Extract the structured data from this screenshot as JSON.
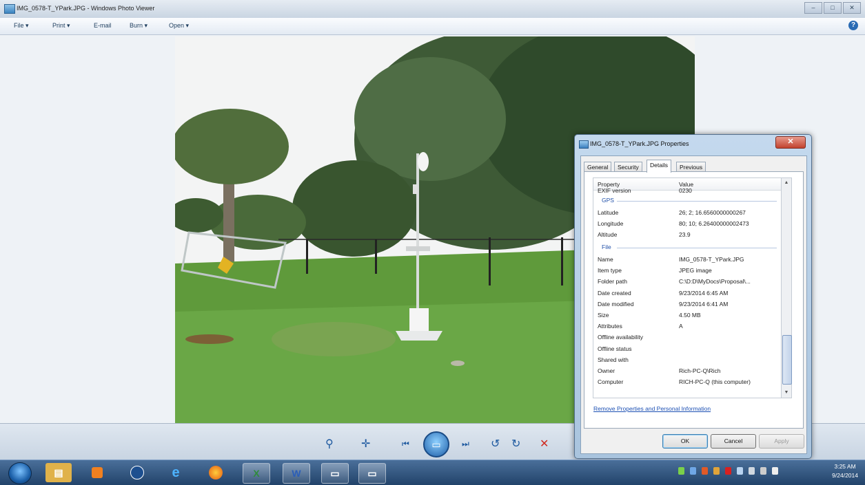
{
  "window": {
    "title": "IMG_0578-T_YPark.JPG - Windows Photo Viewer"
  },
  "menu": [
    {
      "label": "File ▾",
      "name": "menu-file"
    },
    {
      "label": "Print ▾",
      "name": "menu-print"
    },
    {
      "label": "E-mail",
      "name": "menu-email"
    },
    {
      "label": "Burn ▾",
      "name": "menu-burn"
    },
    {
      "label": "Open ▾",
      "name": "menu-open"
    }
  ],
  "dialog": {
    "title": "IMG_0578-T_YPark.JPG Properties",
    "tabs": [
      "General",
      "Security",
      "Details",
      "Previous Versions"
    ],
    "selected_tab": "Details",
    "col_property": "Property",
    "col_value": "Value",
    "cut_row": {
      "k": "EXIF version",
      "v": "0230"
    },
    "gps_group": "GPS",
    "gps": [
      {
        "k": "Latitude",
        "v": "26; 2; 16.6560000000267"
      },
      {
        "k": "Longitude",
        "v": "80; 10; 6.26400000002473"
      },
      {
        "k": "Altitude",
        "v": "23.9"
      }
    ],
    "file_group": "File",
    "file": [
      {
        "k": "Name",
        "v": "IMG_0578-T_YPark.JPG"
      },
      {
        "k": "Item type",
        "v": "JPEG image"
      },
      {
        "k": "Folder path",
        "v": "C:\\D:D\\MyDocs\\Proposal\\..."
      },
      {
        "k": "Date created",
        "v": "9/23/2014 6:45 AM"
      },
      {
        "k": "Date modified",
        "v": "9/23/2014 6:41 AM"
      },
      {
        "k": "Size",
        "v": "4.50 MB"
      },
      {
        "k": "Attributes",
        "v": "A"
      },
      {
        "k": "Offline availability",
        "v": ""
      },
      {
        "k": "Offline status",
        "v": ""
      },
      {
        "k": "Shared with",
        "v": ""
      },
      {
        "k": "Owner",
        "v": "Rich-PC-Q\\Rich"
      },
      {
        "k": "Computer",
        "v": "RICH-PC-Q (this computer)"
      }
    ],
    "remove_link": "Remove Properties and Personal Information",
    "buttons": {
      "ok": "OK",
      "cancel": "Cancel",
      "apply": "Apply"
    }
  },
  "taskbar": {
    "time": "3:25 AM",
    "date": "9/24/2014"
  }
}
